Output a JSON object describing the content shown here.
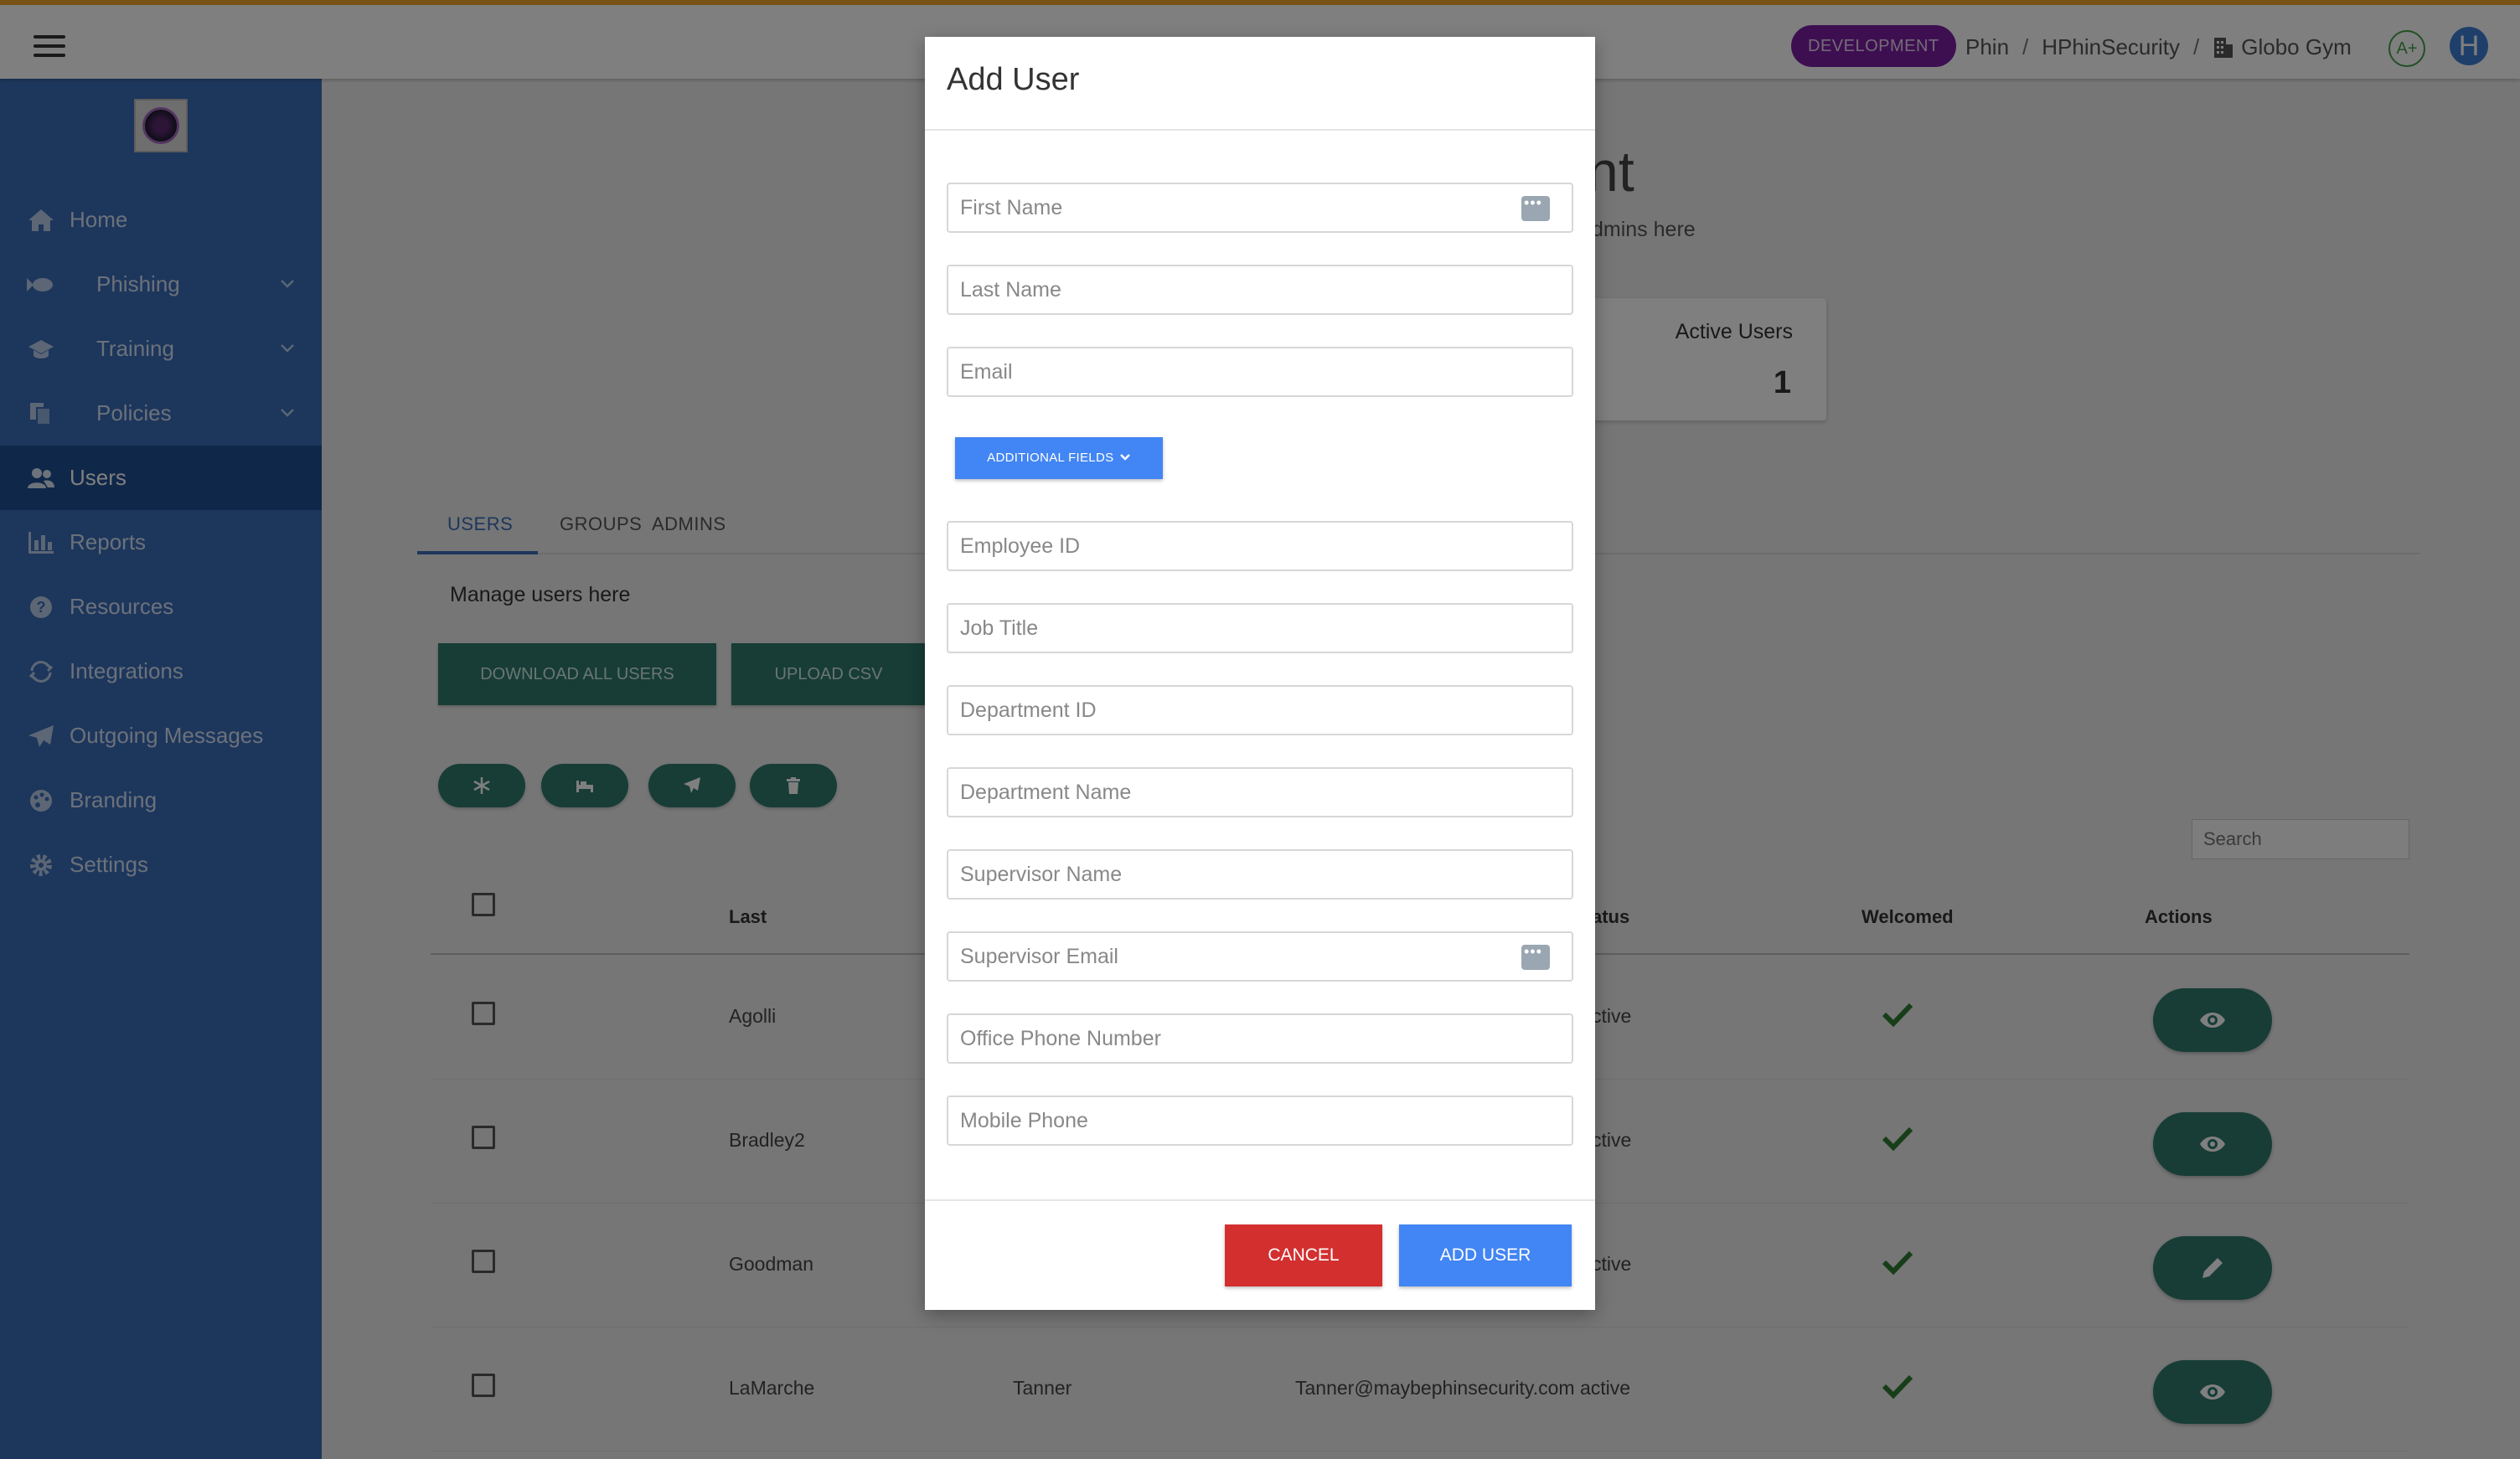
{
  "topbar": {
    "env_badge": "DEVELOPMENT",
    "breadcrumb": [
      "Phin",
      "HPhinSecurity",
      "Globo Gym"
    ],
    "breadcrumb_sep": "/",
    "grade": "A+",
    "avatar_letter": "H",
    "accent_color": "#f2a72c"
  },
  "sidebar": {
    "items": [
      {
        "label": "Home",
        "icon": "home-icon"
      },
      {
        "label": "Phishing",
        "icon": "fish-icon",
        "expandable": true
      },
      {
        "label": "Training",
        "icon": "graduation-cap-icon",
        "expandable": true
      },
      {
        "label": "Policies",
        "icon": "documents-icon",
        "expandable": true
      },
      {
        "label": "Users",
        "icon": "users-icon",
        "active": true
      },
      {
        "label": "Reports",
        "icon": "bar-chart-icon"
      },
      {
        "label": "Resources",
        "icon": "question-circle-icon"
      },
      {
        "label": "Integrations",
        "icon": "sync-icon"
      },
      {
        "label": "Outgoing Messages",
        "icon": "paper-plane-icon"
      },
      {
        "label": "Branding",
        "icon": "palette-icon"
      },
      {
        "label": "Settings",
        "icon": "gear-icon"
      }
    ],
    "color": "#3a6db8",
    "active_color": "#1f4f92"
  },
  "page": {
    "title_fragment": "nt",
    "subtitle_fragment": "dmins here",
    "stat": {
      "label": "Active Users",
      "value": "1"
    },
    "tabs": [
      "USERS",
      "GROUPS",
      "ADMINS"
    ],
    "manage_text": "Manage users here",
    "download_button": "DOWNLOAD ALL USERS",
    "upload_button": "UPLOAD CSV",
    "search_placeholder": "Search",
    "table": {
      "headers": {
        "last": "Last",
        "status": "atus",
        "welcomed": "Welcomed",
        "actions": "Actions"
      },
      "rows": [
        {
          "last": "Agolli",
          "first": "",
          "email_status": "ctive",
          "welcomed": true,
          "action": "view"
        },
        {
          "last": "Bradley2",
          "first": "",
          "email_status": "ctive",
          "welcomed": true,
          "action": "view"
        },
        {
          "last": "Goodman",
          "first": "",
          "email_status": "ctive",
          "welcomed": true,
          "action": "edit"
        },
        {
          "last": "LaMarche",
          "first": "Tanner",
          "email_status": "Tanner@maybephinsecurity.com active",
          "welcomed": true,
          "action": "view"
        }
      ]
    }
  },
  "modal": {
    "title": "Add User",
    "fields": {
      "first_name": "First Name",
      "last_name": "Last Name",
      "email": "Email",
      "employee_id": "Employee ID",
      "job_title": "Job Title",
      "department_id": "Department ID",
      "department_name": "Department Name",
      "supervisor_name": "Supervisor Name",
      "supervisor_email": "Supervisor Email",
      "office_phone": "Office Phone Number",
      "mobile_phone": "Mobile Phone"
    },
    "additional_fields_button": "ADDITIONAL FIELDS",
    "cancel_button": "CANCEL",
    "add_button": "ADD USER"
  }
}
